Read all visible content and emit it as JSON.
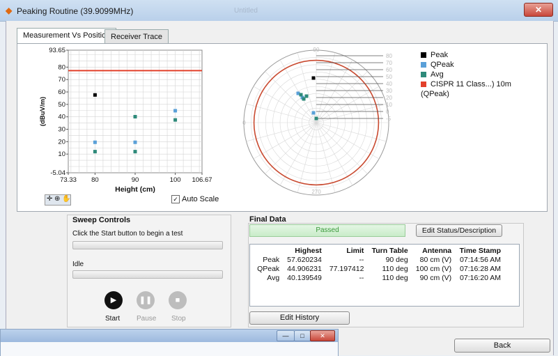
{
  "window": {
    "title": "Peaking Routine (39.9099MHz)",
    "background_title": "Untitled",
    "close_glyph": "✕"
  },
  "tabs": [
    {
      "label": "Measurement Vs Position",
      "active": true
    },
    {
      "label": "Receiver Trace",
      "active": false
    }
  ],
  "chart_data": [
    {
      "type": "scatter",
      "title": "",
      "xlabel": "Height (cm)",
      "ylabel": "(dBuV/m)",
      "xlim": [
        73.33,
        106.67
      ],
      "ylim": [
        -5.04,
        93.65
      ],
      "x_ticks": [
        "73.33",
        "80",
        "90",
        "100",
        "106.67"
      ],
      "y_ticks": [
        "93.65",
        "80",
        "70",
        "60",
        "50",
        "40",
        "30",
        "20",
        "10",
        "-5.04"
      ],
      "grid": true,
      "limit_line": {
        "name": "CISPR 11 Class...) 10m (QPeak)",
        "y": 77.2,
        "color": "#e2402a"
      },
      "series": [
        {
          "name": "Peak",
          "color": "#000000",
          "points": [
            [
              80,
              57.6
            ]
          ]
        },
        {
          "name": "QPeak",
          "color": "#5aa0d8",
          "points": [
            [
              80,
              19.5
            ],
            [
              90,
              19.5
            ],
            [
              100,
              44.9
            ]
          ]
        },
        {
          "name": "Avg",
          "color": "#2e8a7a",
          "points": [
            [
              80,
              12
            ],
            [
              90,
              12
            ],
            [
              90,
              40.1
            ],
            [
              100,
              37.5
            ]
          ]
        }
      ]
    },
    {
      "type": "polar",
      "title": "",
      "angle_labels": [
        "90",
        "180",
        "270"
      ],
      "radial_labels": [
        "80",
        "70",
        "60",
        "50",
        "40",
        "30",
        "20",
        "10",
        "0",
        "-5"
      ],
      "limit_circle_color": "#c94a30",
      "series": [
        {
          "name": "Peak",
          "color": "#000000"
        },
        {
          "name": "QPeak",
          "color": "#5aa0d8"
        },
        {
          "name": "Avg",
          "color": "#2e8a7a"
        }
      ]
    }
  ],
  "legend": [
    {
      "label": "Peak",
      "color": "#000000"
    },
    {
      "label": "QPeak",
      "color": "#5aa0d8"
    },
    {
      "label": "Avg",
      "color": "#2e8a7a"
    },
    {
      "label": "CISPR 11 Class...) 10m (QPeak)",
      "color": "#e2402a"
    }
  ],
  "chart_toolbar": {
    "icons": [
      "crosshair-icon",
      "zoom-icon",
      "pan-icon"
    ]
  },
  "auto_scale": {
    "label": "Auto Scale",
    "checked": true,
    "check_glyph": "✓"
  },
  "sweep": {
    "title": "Sweep Controls",
    "instruction": "Click the Start button to begin a test",
    "status": "Idle",
    "start_label": "Start",
    "start_glyph": "▶",
    "pause_label": "Pause",
    "pause_glyph": "❚❚",
    "stop_label": "Stop",
    "stop_glyph": "■"
  },
  "final_data": {
    "title": "Final Data",
    "status": "Passed",
    "status_color": "#7ed07e",
    "edit_status_label": "Edit Status/Description",
    "edit_history_label": "Edit History",
    "columns": [
      "",
      "Highest",
      "Limit",
      "Turn Table",
      "Antenna",
      "Time Stamp"
    ],
    "rows": [
      [
        "Peak",
        "57.620234",
        "--",
        "90 deg",
        "80 cm (V)",
        "07:14:56 AM"
      ],
      [
        "QPeak",
        "44.906231",
        "77.197412",
        "110 deg",
        "100 cm (V)",
        "07:16:28 AM"
      ],
      [
        "Avg",
        "40.139549",
        "--",
        "110 deg",
        "90 cm (V)",
        "07:16:20 AM"
      ]
    ]
  },
  "back_label": "Back",
  "overlay_window": {
    "minimize_glyph": "—",
    "maximize_glyph": "□",
    "close_glyph": "✕"
  }
}
